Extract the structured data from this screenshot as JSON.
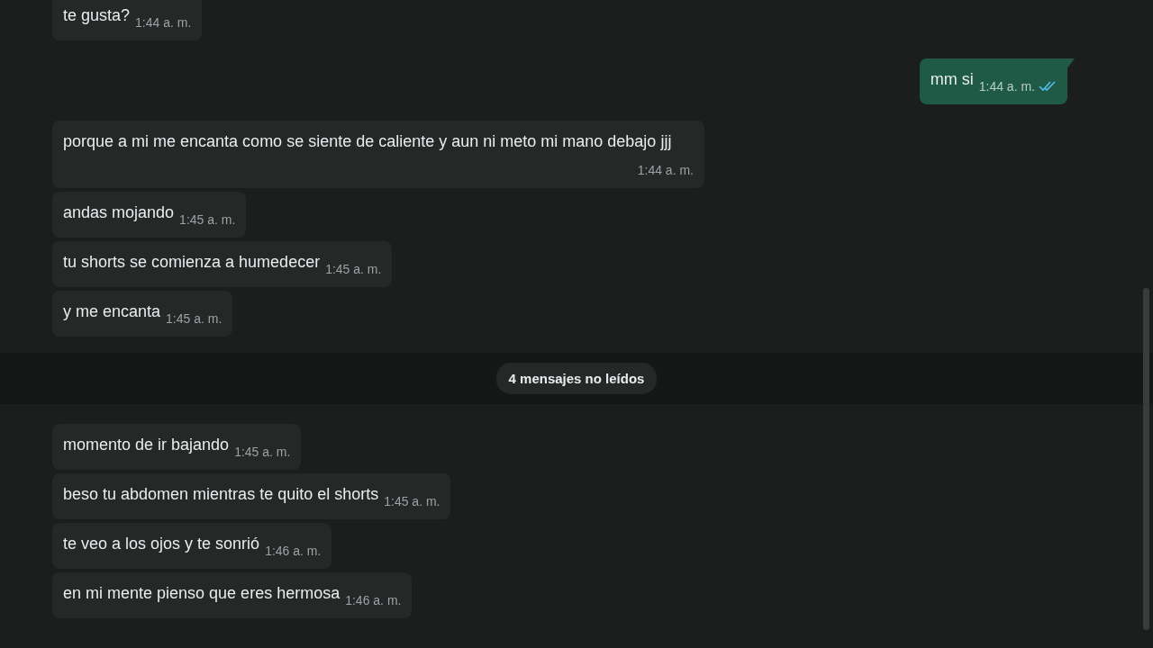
{
  "messages": [
    {
      "kind": "incoming",
      "text": "te gusta?",
      "time": "1:44 a. m."
    },
    {
      "kind": "outgoing",
      "text": "mm si",
      "time": "1:44 a. m.",
      "read": true
    },
    {
      "kind": "incoming",
      "text": "porque a mi me encanta como se siente de caliente y aun ni meto mi mano debajo jjj",
      "time": "1:44 a. m."
    },
    {
      "kind": "incoming",
      "text": "andas mojando",
      "time": "1:45 a. m."
    },
    {
      "kind": "incoming",
      "text": "tu shorts se comienza a humedecer",
      "time": "1:45 a. m."
    },
    {
      "kind": "incoming",
      "text": "y me encanta",
      "time": "1:45 a. m."
    },
    {
      "kind": "unread_divider",
      "text": "4 mensajes no leídos"
    },
    {
      "kind": "incoming",
      "text": "momento de ir bajando",
      "time": "1:45 a. m."
    },
    {
      "kind": "incoming",
      "text": "beso tu abdomen mientras te quito el shorts",
      "time": "1:45 a. m."
    },
    {
      "kind": "incoming",
      "text": "te veo a los ojos y te sonrió",
      "time": "1:46 a. m."
    },
    {
      "kind": "incoming",
      "text": "en mi mente pienso que eres hermosa",
      "time": "1:46 a. m."
    }
  ]
}
